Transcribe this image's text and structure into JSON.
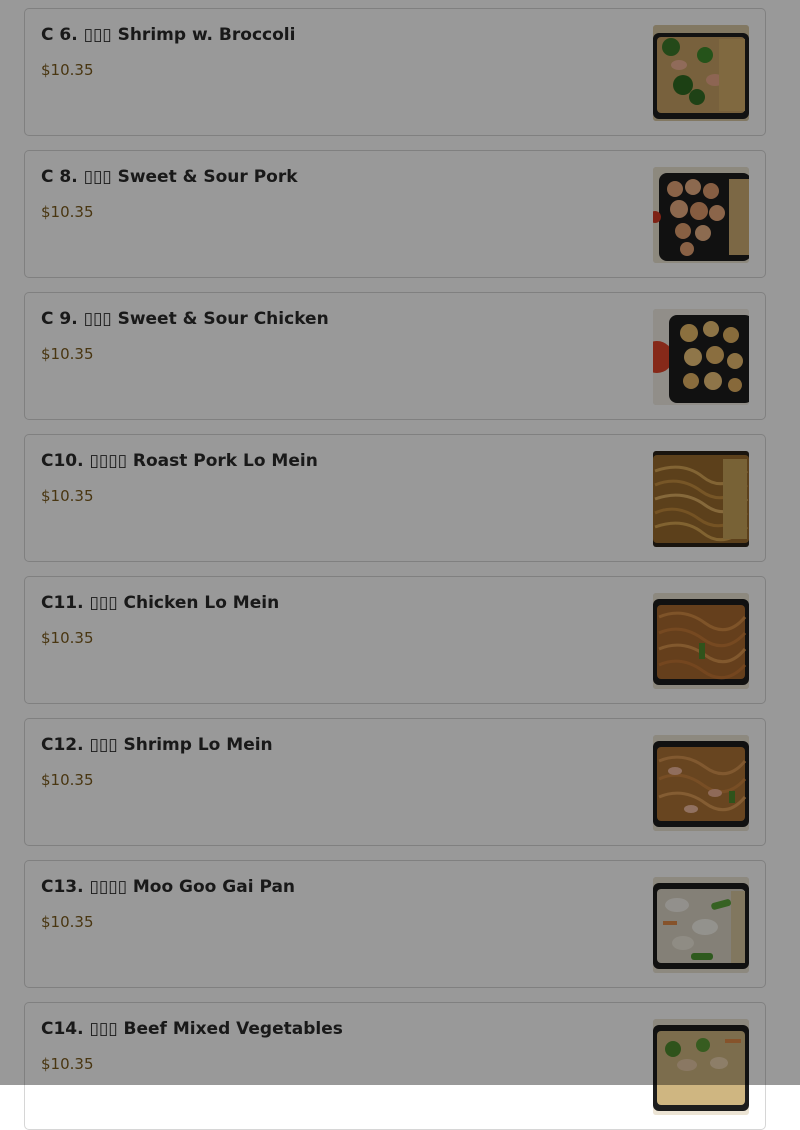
{
  "menu_items": [
    {
      "title": "C 6. ▯▯▯ Shrimp w. Broccoli",
      "price": "$10.35",
      "image_icon": "shrimp-broccoli-food-image"
    },
    {
      "title": "C 8. ▯▯▯ Sweet & Sour Pork",
      "price": "$10.35",
      "image_icon": "sweet-sour-pork-food-image"
    },
    {
      "title": "C 9. ▯▯▯ Sweet & Sour Chicken",
      "price": "$10.35",
      "image_icon": "sweet-sour-chicken-food-image"
    },
    {
      "title": "C10. ▯▯▯▯ Roast Pork Lo Mein",
      "price": "$10.35",
      "image_icon": "roast-pork-lo-mein-food-image"
    },
    {
      "title": "C11. ▯▯▯ Chicken Lo Mein",
      "price": "$10.35",
      "image_icon": "chicken-lo-mein-food-image"
    },
    {
      "title": "C12. ▯▯▯ Shrimp Lo Mein",
      "price": "$10.35",
      "image_icon": "shrimp-lo-mein-food-image"
    },
    {
      "title": "C13. ▯▯▯▯ Moo Goo Gai Pan",
      "price": "$10.35",
      "image_icon": "moo-goo-gai-pan-food-image"
    },
    {
      "title": "C14. ▯▯▯ Beef Mixed Vegetables",
      "price": "$10.35",
      "image_icon": "beef-mixed-vegetables-food-image"
    }
  ],
  "colors": {
    "overlay": "rgba(0,0,0,0.40)",
    "price": "#7a5a1d",
    "card_border": "#d6d6d6"
  }
}
